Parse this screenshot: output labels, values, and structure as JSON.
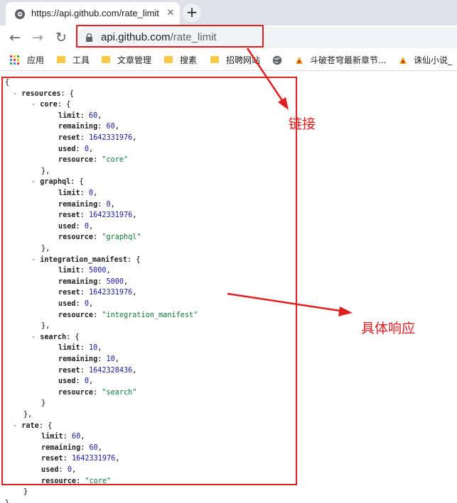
{
  "browser": {
    "tab": {
      "title": "https://api.github.com/rate_limit",
      "close_glyph": "✕"
    },
    "new_tab_glyph": "+",
    "nav": {
      "back_glyph": "←",
      "forward_glyph": "→",
      "reload_glyph": "↻"
    },
    "address": {
      "host": "api.github.com",
      "path": "/rate_limit"
    }
  },
  "bookmarks": [
    {
      "label": "应用",
      "icon": "apps-grid-icon"
    },
    {
      "label": "工具",
      "icon": "folder-icon"
    },
    {
      "label": "文章管理",
      "icon": "folder-icon"
    },
    {
      "label": "搜素",
      "icon": "folder-icon"
    },
    {
      "label": "招聘网站",
      "icon": "folder-icon"
    },
    {
      "label": "",
      "icon": "globe-icon"
    },
    {
      "label": "斗破苍穹最新章节...",
      "icon": "book-icon"
    },
    {
      "label": "诛仙小说_",
      "icon": "book-icon"
    }
  ],
  "response": {
    "open_brace": "{",
    "close_brace": "}",
    "resources_key": "resources",
    "rate_key": "rate",
    "groups": [
      {
        "name": "core",
        "limit": 60,
        "remaining": 60,
        "reset": 1642331976,
        "used": 0,
        "resource": "core"
      },
      {
        "name": "graphql",
        "limit": 0,
        "remaining": 0,
        "reset": 1642331976,
        "used": 0,
        "resource": "graphql"
      },
      {
        "name": "integration_manifest",
        "limit": 5000,
        "remaining": 5000,
        "reset": 1642331976,
        "used": 0,
        "resource": "integration_manifest"
      },
      {
        "name": "search",
        "limit": 10,
        "remaining": 10,
        "reset": 1642328436,
        "used": 0,
        "resource": "search"
      }
    ],
    "rate": {
      "limit": 60,
      "remaining": 60,
      "reset": 1642331976,
      "used": 0,
      "resource": "core"
    },
    "field_names": [
      "limit",
      "remaining",
      "reset",
      "used",
      "resource"
    ]
  },
  "annotations": {
    "link_label": "链接",
    "response_label": "具体响应",
    "color": "#e02020"
  }
}
